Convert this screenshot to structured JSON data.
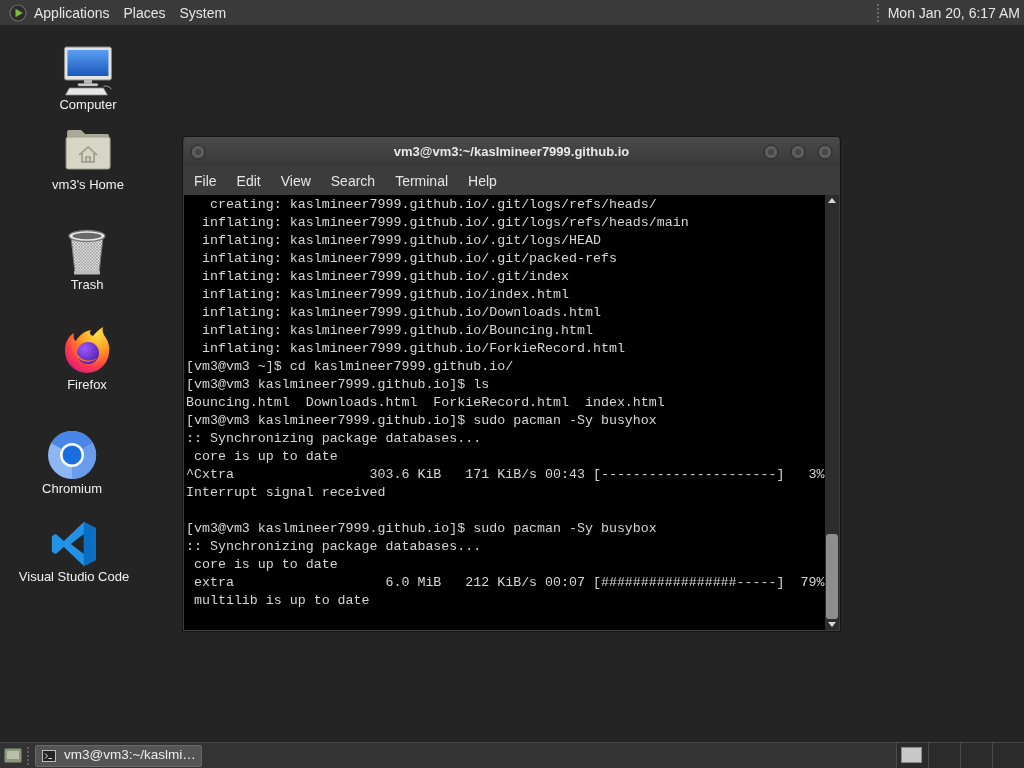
{
  "top_panel": {
    "menus": [
      "Applications",
      "Places",
      "System"
    ],
    "clock": "Mon Jan 20, 6:17 AM"
  },
  "desktop_icons": [
    {
      "kind": "computer",
      "label": "Computer"
    },
    {
      "kind": "home",
      "label": "vm3's Home"
    },
    {
      "kind": "trash",
      "label": "Trash"
    },
    {
      "kind": "firefox",
      "label": "Firefox"
    },
    {
      "kind": "chromium",
      "label": "Chromium"
    },
    {
      "kind": "vscode",
      "label": "Visual Studio Code"
    }
  ],
  "terminal_window": {
    "title": "vm3@vm3:~/kaslmineer7999.github.io",
    "menu": [
      "File",
      "Edit",
      "View",
      "Search",
      "Terminal",
      "Help"
    ],
    "output_blocks": [
      {
        "lines": [
          "   creating: kaslmineer7999.github.io/.git/logs/refs/heads/",
          "  inflating: kaslmineer7999.github.io/.git/logs/refs/heads/main",
          "  inflating: kaslmineer7999.github.io/.git/logs/HEAD",
          "  inflating: kaslmineer7999.github.io/.git/packed-refs",
          "  inflating: kaslmineer7999.github.io/.git/index",
          "  inflating: kaslmineer7999.github.io/index.html",
          "  inflating: kaslmineer7999.github.io/Downloads.html",
          "  inflating: kaslmineer7999.github.io/Bouncing.html",
          "  inflating: kaslmineer7999.github.io/ForkieRecord.html",
          "[vm3@vm3 ~]$ cd kaslmineer7999.github.io/",
          "[vm3@vm3 kaslmineer7999.github.io]$ ls",
          "Bouncing.html  Downloads.html  ForkieRecord.html  index.html",
          "[vm3@vm3 kaslmineer7999.github.io]$ sudo pacman -Sy busyhox",
          ":: Synchronizing package databases...",
          " core is up to date",
          "^Cxtra                 303.6 KiB   171 KiB/s 00:43 [----------------------]   3%",
          "Interrupt signal received"
        ]
      },
      {
        "lines": [
          "[vm3@vm3 kaslmineer7999.github.io]$ sudo pacman -Sy busybox",
          ":: Synchronizing package databases...",
          " core is up to date",
          " extra                   6.0 MiB   212 KiB/s 00:07 [#################-----]  79%",
          " multilib is up to date"
        ]
      }
    ]
  },
  "bottom_panel": {
    "tasks": [
      {
        "label": "vm3@vm3:~/kaslmi…",
        "selected": true
      }
    ]
  }
}
